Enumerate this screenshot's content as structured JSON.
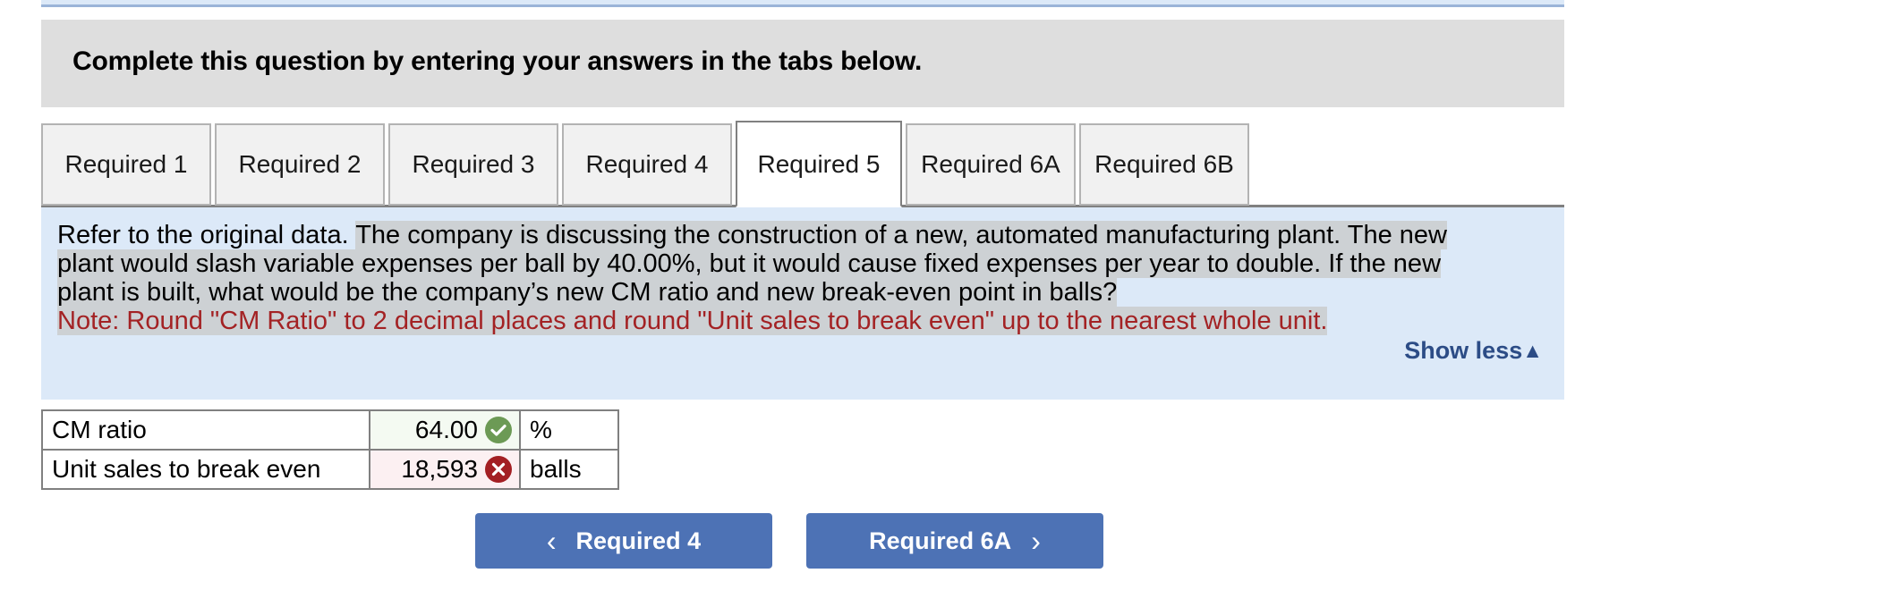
{
  "banner": {
    "instruction": "Complete this question by entering your answers in the tabs below."
  },
  "tabs": {
    "items": [
      {
        "label": "Required 1",
        "selected": false
      },
      {
        "label": "Required 2",
        "selected": false
      },
      {
        "label": "Required 3",
        "selected": false
      },
      {
        "label": "Required 4",
        "selected": false
      },
      {
        "label": "Required 5",
        "selected": true
      },
      {
        "label": "Required 6A",
        "selected": false
      },
      {
        "label": "Required 6B",
        "selected": false
      }
    ]
  },
  "question": {
    "line1_plain": "Refer to the original data. ",
    "line1_highlight": "The company is discussing the construction of a new, automated manufacturing plant. The new",
    "line2": "plant would slash variable expenses per ball by 40.00%, but it would cause fixed expenses per year to double. If the new",
    "line3": "plant is built, what would be the company’s new CM ratio and new break-even point in balls?",
    "note": "Note: Round \"CM Ratio\" to 2 decimal places and round \"Unit sales to break even\" up to the nearest whole unit.",
    "show_less_label": "Show less",
    "show_less_caret": "▲",
    "highlight_color": "#cdd1d4",
    "panel_color": "#dce9f8",
    "note_color": "#a32224",
    "link_color": "#2c4c86"
  },
  "answers": {
    "rows": [
      {
        "label": "CM ratio",
        "value": "64.00",
        "unit": "%",
        "status": "correct",
        "status_icon": "check-circle-icon"
      },
      {
        "label": "Unit sales to break even",
        "value": "18,593",
        "unit": "balls",
        "status": "incorrect",
        "status_icon": "x-circle-icon"
      }
    ],
    "correct_color": "#6c9a55",
    "incorrect_color": "#a31f23"
  },
  "navigation": {
    "prev_label": "Required 4",
    "prev_icon": "chevron-left-icon",
    "prev_chevron": "‹",
    "next_label": "Required 6A",
    "next_icon": "chevron-right-icon",
    "next_chevron": "›",
    "button_color": "#4d72b5"
  }
}
